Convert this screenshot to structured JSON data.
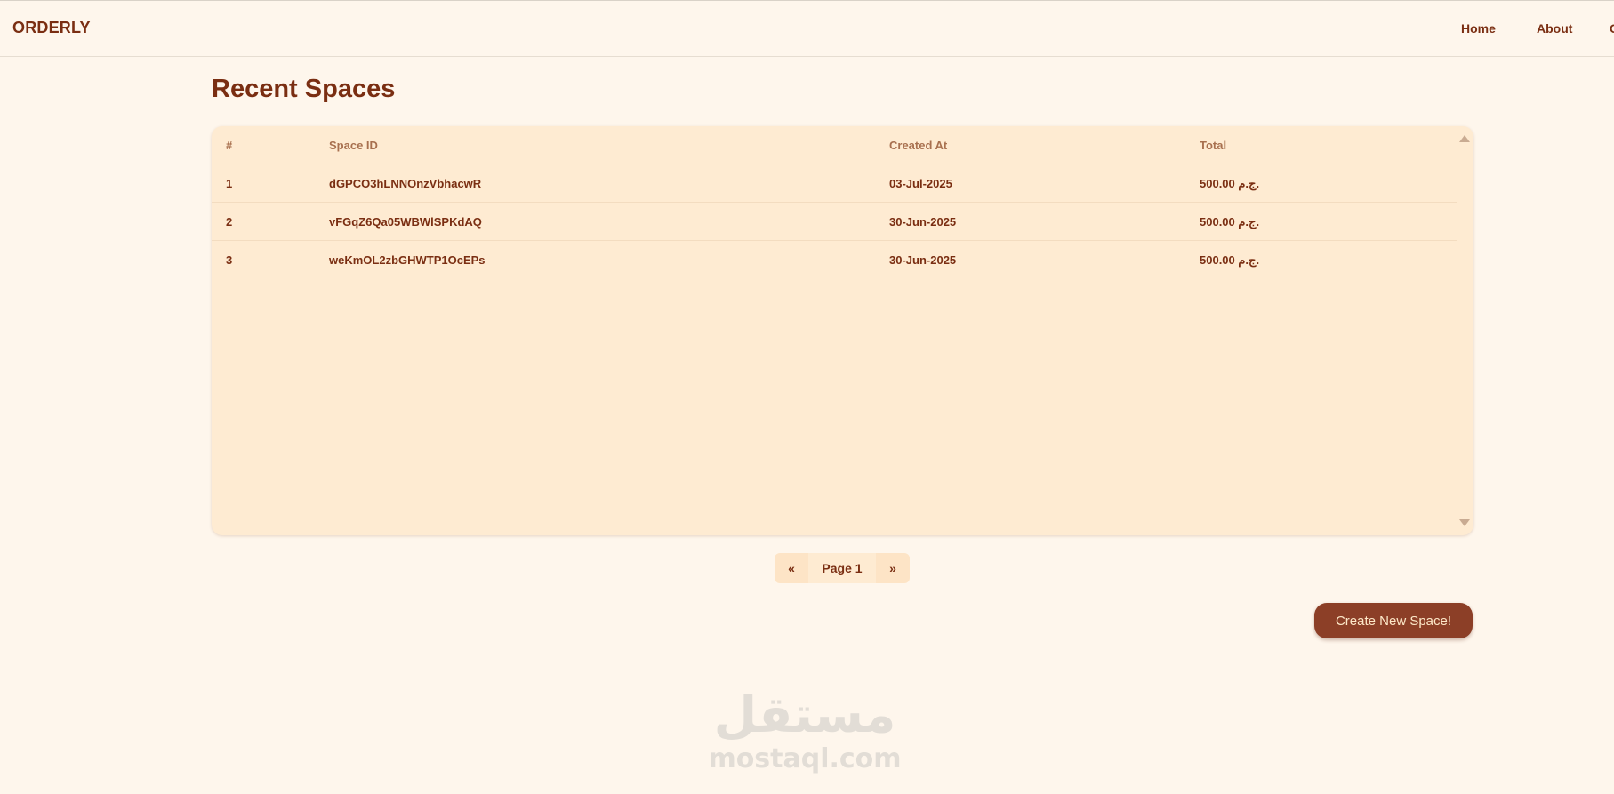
{
  "header": {
    "brand": "ORDERLY",
    "nav": [
      "Home",
      "About",
      "C"
    ]
  },
  "main": {
    "title": "Recent Spaces",
    "table": {
      "columns": [
        "#",
        "Space ID",
        "Created At",
        "Total"
      ],
      "rows": [
        [
          "1",
          "dGPCO3hLNNOnzVbhacwR",
          "03-Jul-2025",
          "500.00 ج.م."
        ],
        [
          "2",
          "vFGqZ6Qa05WBWlSPKdAQ",
          "30-Jun-2025",
          "500.00 ج.م."
        ],
        [
          "3",
          "weKmOL2zbGHWTP1OcEPs",
          "30-Jun-2025",
          "500.00 ج.م."
        ]
      ]
    },
    "pagination": {
      "prev": "«",
      "label": "Page 1",
      "next": "»"
    },
    "create_button": "Create New Space!"
  },
  "watermark": {
    "arabic": "مستقل",
    "latin": "mostaql.com"
  }
}
